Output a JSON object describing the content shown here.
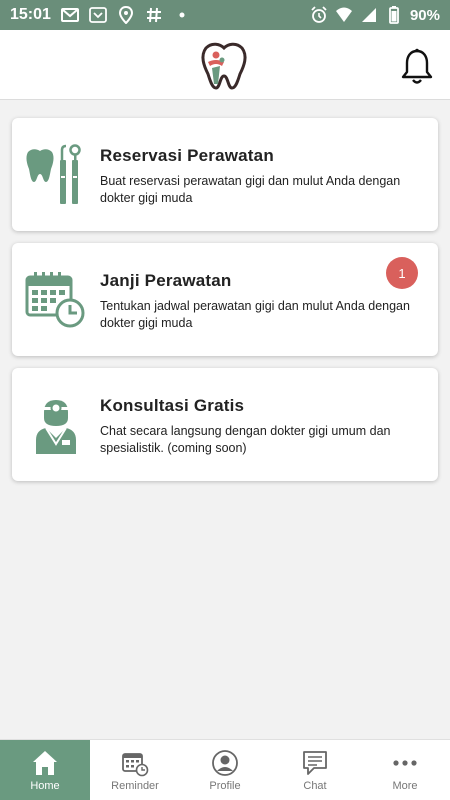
{
  "status_bar": {
    "time": "15:01",
    "battery": "90%"
  },
  "header": {
    "logo_icon": "tooth-logo-icon",
    "notification_icon": "bell-icon"
  },
  "colors": {
    "accent": "#6a9a80",
    "icon_green": "#6a9a80",
    "badge": "#d9605c"
  },
  "cards": [
    {
      "title": "Reservasi Perawatan",
      "description": "Buat reservasi perawatan gigi dan mulut Anda dengan dokter gigi muda",
      "icon": "dental-tools-icon"
    },
    {
      "title": "Janji Perawatan",
      "description": "Tentukan jadwal perawatan gigi dan mulut Anda dengan dokter gigi muda",
      "icon": "calendar-clock-icon",
      "badge": "1"
    },
    {
      "title": "Konsultasi Gratis",
      "description": "Chat secara langsung dengan dokter gigi umum dan spesialistik. (coming soon)",
      "icon": "dentist-icon"
    }
  ],
  "bottom_nav": [
    {
      "label": "Home",
      "icon": "home-icon",
      "active": true
    },
    {
      "label": "Reminder",
      "icon": "calendar-icon"
    },
    {
      "label": "Profile",
      "icon": "profile-icon"
    },
    {
      "label": "Chat",
      "icon": "chat-icon"
    },
    {
      "label": "More",
      "icon": "more-icon"
    }
  ]
}
